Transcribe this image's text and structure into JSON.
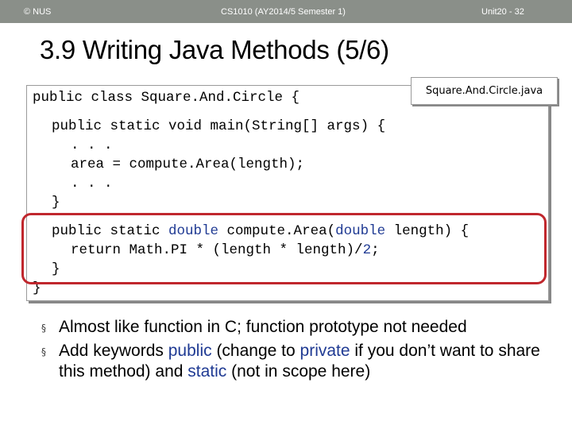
{
  "header": {
    "left": "© NUS",
    "center": "CS1010 (AY2014/5 Semester 1)",
    "right": "Unit20 - 32"
  },
  "slide": {
    "title": "3.9 Writing Java Methods (5/6)"
  },
  "file_label": "Square.And.Circle.java",
  "code": {
    "class_line": "public class Square.And.Circle {",
    "main_sig": "public static void main(String[] args) {",
    "ellipsis1": ". . .",
    "assign": "area = compute.Area(length);",
    "ellipsis2": ". . .",
    "main_close": "}",
    "method_sig_pre": "public static ",
    "method_kw_double1": "double",
    "method_sig_mid": " compute.Area(",
    "method_kw_double2": "double",
    "method_sig_post": " length) {",
    "return_pre": "return Math.PI * (length * length)/",
    "return_num": "2",
    "return_post": ";",
    "method_close": "}",
    "class_close": "}"
  },
  "bullets": {
    "b1": "Almost like function in C; function prototype not needed",
    "b2_p1": "Add keywords ",
    "b2_kw1": "public",
    "b2_p2": " (change to ",
    "b2_kw2": "private",
    "b2_p3": " if you don’t want to share this method) and ",
    "b2_kw3": "static",
    "b2_p4": " (not in scope here)",
    "marker": "§"
  },
  "colors": {
    "header_bg": "#8a8f89",
    "highlight": "#c0272d",
    "keyword_blue": "#1f3a93"
  }
}
